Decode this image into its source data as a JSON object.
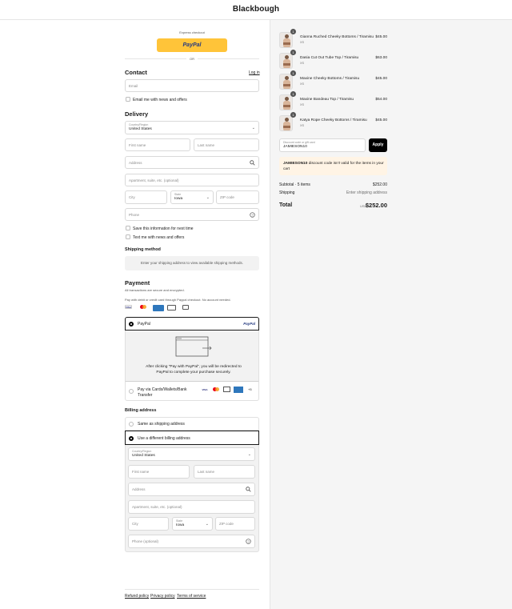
{
  "brand": "Blackbough",
  "express": {
    "label": "Express checkout",
    "paypal": "PayPal",
    "or": "OR"
  },
  "contact": {
    "title": "Contact",
    "login": "Log in",
    "email_placeholder": "Email",
    "news": "Email me with news and offers"
  },
  "delivery": {
    "title": "Delivery",
    "country_label": "Country/Region",
    "country": "United States",
    "first": "First name",
    "last": "Last name",
    "address": "Address",
    "apt": "Apartment, suite, etc. (optional)",
    "city": "City",
    "state_label": "State",
    "state": "Iowa",
    "zip": "ZIP code",
    "phone": "Phone",
    "save": "Save this information for next time",
    "text": "Text me with news and offers"
  },
  "shipping": {
    "title": "Shipping method",
    "note": "Enter your shipping address to view available shipping methods."
  },
  "payment": {
    "title": "Payment",
    "secure": "All transactions are secure and encrypted.",
    "pay_note": "Pay with debit or credit card through Paypal checkout. No account needed.",
    "paypal_option": "PayPal",
    "paypal_logo": "PayPal",
    "redirect": "After clicking \"Pay with PayPal\", you will be redirected to PayPal to complete your purchase securely.",
    "cards_option": "Pay via Cards/Wallets/Bank Transfer",
    "more": "+5",
    "card_labels": [
      "VISA",
      "",
      "AMEX",
      ""
    ],
    "colors": {
      "visa": "#1a1f71",
      "mc": "#eb001b",
      "amex": "#2e77bc",
      "paypal": "#ffc439"
    }
  },
  "billing": {
    "title": "Billing address",
    "same": "Same as shipping address",
    "different": "Use a different billing address",
    "country_label": "Country/Region",
    "country": "United States",
    "first": "First name",
    "last": "Last name",
    "address": "Address",
    "apt": "Apartment, suite, etc. (optional)",
    "city": "City",
    "state_label": "State",
    "state": "Iowa",
    "zip": "ZIP code",
    "phone": "Phone (optional)"
  },
  "footer": {
    "refund": "Refund policy",
    "privacy": "Privacy policy",
    "terms": "Terms of service"
  },
  "items": [
    {
      "name": "Gianna Ruched Cheeky Bottoms / Tiramisu",
      "size": "XS",
      "price": "$45.00",
      "qty": "1"
    },
    {
      "name": "Dasia Cut Out Tube Top / Tiramisu",
      "size": "XS",
      "price": "$63.00",
      "qty": "1"
    },
    {
      "name": "Maxine Cheeky Bottoms / Tiramisu",
      "size": "XS",
      "price": "$45.00",
      "qty": "1"
    },
    {
      "name": "Maxine Bandeau Top / Tiramisu",
      "size": "XS",
      "price": "$54.00",
      "qty": "1"
    },
    {
      "name": "Katya Rope Cheeky Bottoms / Tiramisu",
      "size": "XS",
      "price": "$45.00",
      "qty": "1"
    }
  ],
  "discount": {
    "label": "Discount code or gift card",
    "value": "JAMIESON10",
    "apply": "Apply",
    "error_code": "JAMIESON10",
    "error_text": " discount code isn't valid for the items in your cart"
  },
  "totals": {
    "subtotal_label": "Subtotal · 5 items",
    "subtotal": "$252.00",
    "shipping_label": "Shipping",
    "shipping": "Enter shipping address",
    "total_label": "Total",
    "currency": "USD",
    "total": "$252.00"
  }
}
